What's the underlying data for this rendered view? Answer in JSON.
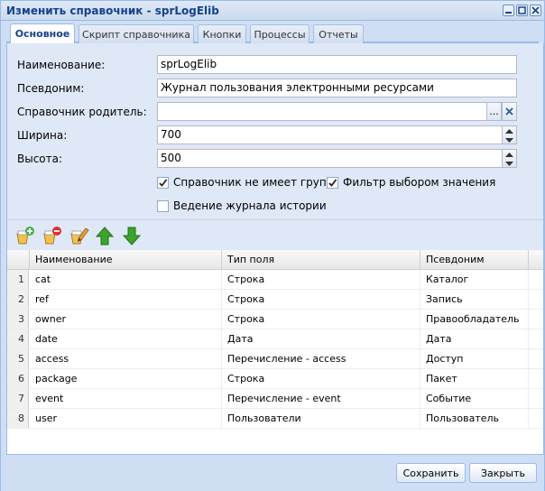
{
  "window": {
    "title": "Изменить справочник - sprLogElib",
    "tools": {
      "minimize": "minimize-icon",
      "maximize": "maximize-icon",
      "close": "close-icon"
    }
  },
  "tabs": [
    {
      "label": "Основное",
      "active": true
    },
    {
      "label": "Скрипт справочника",
      "active": false
    },
    {
      "label": "Кнопки",
      "active": false
    },
    {
      "label": "Процессы",
      "active": false
    },
    {
      "label": "Отчеты",
      "active": false
    }
  ],
  "form": {
    "name_label": "Наименование:",
    "name_value": "sprLogElib",
    "alias_label": "Псевдоним:",
    "alias_value": "Журнал пользования электронными ресурсами",
    "parent_label": "Справочник родитель:",
    "parent_value": "",
    "parent_browse": "...",
    "width_label": "Ширина:",
    "width_value": "700",
    "height_label": "Высота:",
    "height_value": "500",
    "no_groups_label": "Справочник не имеет групп",
    "no_groups_checked": true,
    "filter_label": "Фильтр выбором значения",
    "filter_checked": true,
    "history_label": "Ведение журнала истории",
    "history_checked": false
  },
  "toolbar": {
    "icons": [
      "add-field-icon",
      "delete-field-icon",
      "edit-field-icon",
      "move-up-icon",
      "move-down-icon"
    ]
  },
  "grid": {
    "columns": [
      "Наименование",
      "Тип поля",
      "Псевдоним"
    ],
    "rows": [
      {
        "n": "1",
        "name": "cat",
        "type": "Строка",
        "alias": "Каталог"
      },
      {
        "n": "2",
        "name": "ref",
        "type": "Строка",
        "alias": "Запись"
      },
      {
        "n": "3",
        "name": "owner",
        "type": "Строка",
        "alias": "Правообладатель"
      },
      {
        "n": "4",
        "name": "date",
        "type": "Дата",
        "alias": "Дата"
      },
      {
        "n": "5",
        "name": "access",
        "type": "Перечисление - access",
        "alias": "Доступ"
      },
      {
        "n": "6",
        "name": "package",
        "type": "Строка",
        "alias": "Пакет"
      },
      {
        "n": "7",
        "name": "event",
        "type": "Перечисление - event",
        "alias": "Событие"
      },
      {
        "n": "8",
        "name": "user",
        "type": "Пользователи",
        "alias": "Пользователь"
      }
    ]
  },
  "footer": {
    "save_label": "Сохранить",
    "close_label": "Закрыть"
  },
  "colors": {
    "window_bg": "#cfdef3",
    "title_text": "#15428b",
    "delete_red": "#e03030",
    "arrow_green": "#3aa52a"
  }
}
